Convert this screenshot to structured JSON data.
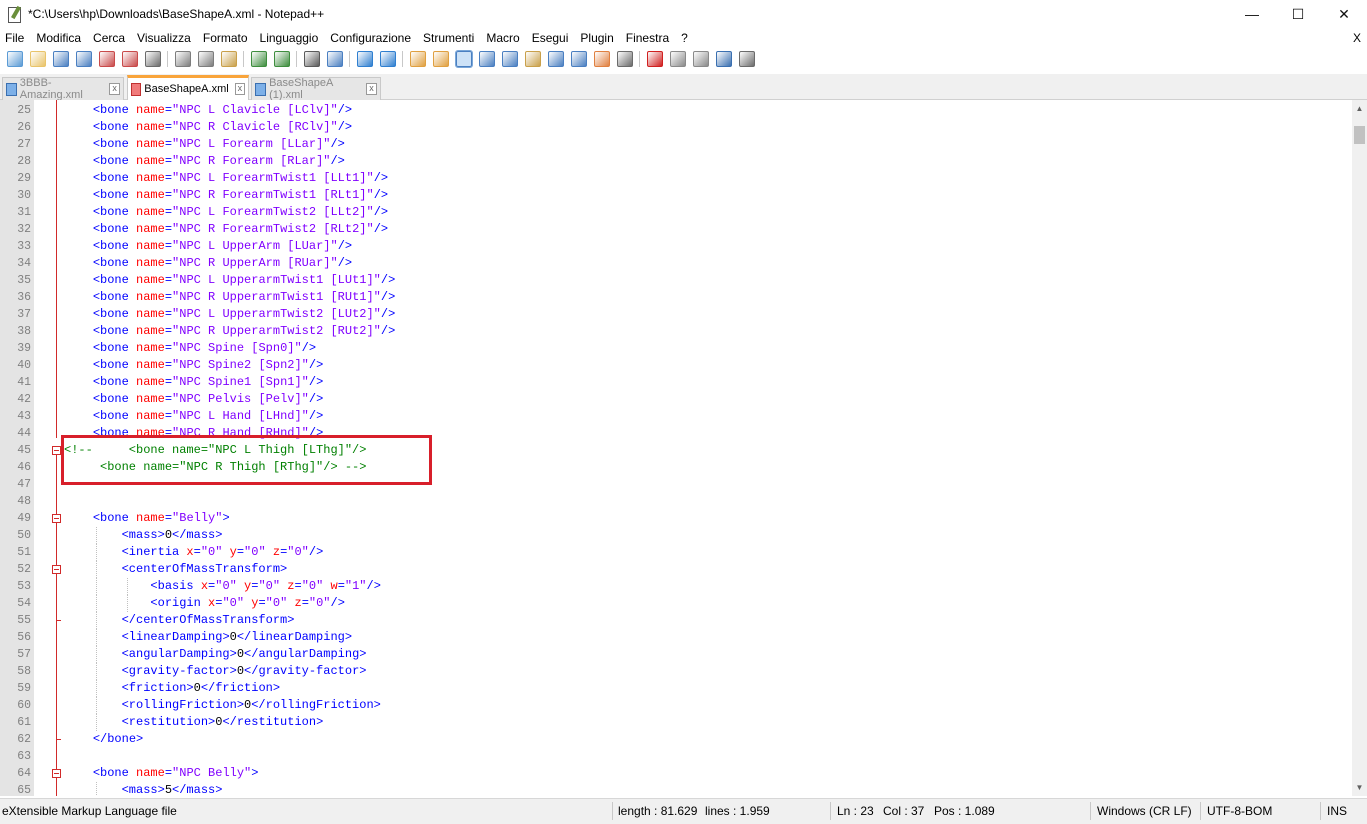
{
  "window": {
    "title": "*C:\\Users\\hp\\Downloads\\BaseShapeA.xml - Notepad++",
    "minimize_glyph": "—",
    "maximize_glyph": "☐",
    "close_glyph": "✕"
  },
  "menu": {
    "items": [
      "File",
      "Modifica",
      "Cerca",
      "Visualizza",
      "Formato",
      "Linguaggio",
      "Configurazione",
      "Strumenti",
      "Macro",
      "Esegui",
      "Plugin",
      "Finestra",
      "?"
    ],
    "close_glyph": "X"
  },
  "toolbar": {
    "buttons": [
      "new-file",
      "open-file",
      "save",
      "save-all",
      "close",
      "close-all",
      "print",
      "cut",
      "copy",
      "paste",
      "undo",
      "redo",
      "find",
      "replace",
      "zoom-in",
      "zoom-out",
      "sync-vertical",
      "sync-horizontal",
      "word-wrap",
      "show-all-characters",
      "indent-guide",
      "define-language",
      "document-map",
      "function-list",
      "folder-as-workspace",
      "monitoring",
      "record-macro",
      "stop-recording",
      "playback-macro",
      "run-macro-multiple",
      "save-macro"
    ]
  },
  "tabs": [
    {
      "label": "3BBB-Amazing.xml",
      "active": false,
      "close": "x"
    },
    {
      "label": "BaseShapeA.xml",
      "active": true,
      "close": "x"
    },
    {
      "label": "BaseShapeA (1).xml",
      "active": false,
      "close": "x"
    }
  ],
  "editor": {
    "lines": [
      {
        "n": "25",
        "text": "    <bone name=\"NPC L Clavicle [LClv]\"/>"
      },
      {
        "n": "26",
        "text": "    <bone name=\"NPC R Clavicle [RClv]\"/>"
      },
      {
        "n": "27",
        "text": "    <bone name=\"NPC L Forearm [LLar]\"/>"
      },
      {
        "n": "28",
        "text": "    <bone name=\"NPC R Forearm [RLar]\"/>"
      },
      {
        "n": "29",
        "text": "    <bone name=\"NPC L ForearmTwist1 [LLt1]\"/>"
      },
      {
        "n": "30",
        "text": "    <bone name=\"NPC R ForearmTwist1 [RLt1]\"/>"
      },
      {
        "n": "31",
        "text": "    <bone name=\"NPC L ForearmTwist2 [LLt2]\"/>"
      },
      {
        "n": "32",
        "text": "    <bone name=\"NPC R ForearmTwist2 [RLt2]\"/>"
      },
      {
        "n": "33",
        "text": "    <bone name=\"NPC L UpperArm [LUar]\"/>"
      },
      {
        "n": "34",
        "text": "    <bone name=\"NPC R UpperArm [RUar]\"/>"
      },
      {
        "n": "35",
        "text": "    <bone name=\"NPC L UpperarmTwist1 [LUt1]\"/>"
      },
      {
        "n": "36",
        "text": "    <bone name=\"NPC R UpperarmTwist1 [RUt1]\"/>"
      },
      {
        "n": "37",
        "text": "    <bone name=\"NPC L UpperarmTwist2 [LUt2]\"/>"
      },
      {
        "n": "38",
        "text": "    <bone name=\"NPC R UpperarmTwist2 [RUt2]\"/>"
      },
      {
        "n": "39",
        "text": "    <bone name=\"NPC Spine [Spn0]\"/>"
      },
      {
        "n": "40",
        "text": "    <bone name=\"NPC Spine2 [Spn2]\"/>"
      },
      {
        "n": "41",
        "text": "    <bone name=\"NPC Spine1 [Spn1]\"/>"
      },
      {
        "n": "42",
        "text": "    <bone name=\"NPC Pelvis [Pelv]\"/>"
      },
      {
        "n": "43",
        "text": "    <bone name=\"NPC L Hand [LHnd]\"/>"
      },
      {
        "n": "44",
        "text": "    <bone name=\"NPC R Hand [RHnd]\"/>"
      },
      {
        "n": "45",
        "text": "<!--     <bone name=\"NPC L Thigh [LThg]\"/>",
        "comment": true,
        "fold": "start"
      },
      {
        "n": "46",
        "text": "     <bone name=\"NPC R Thigh [RThg]\"/> -->",
        "comment": true
      },
      {
        "n": "47",
        "text": ""
      },
      {
        "n": "48",
        "text": ""
      },
      {
        "n": "49",
        "text": "    <bone name=\"Belly\">",
        "fold": "start"
      },
      {
        "n": "50",
        "text": "        <mass>0</mass>"
      },
      {
        "n": "51",
        "text": "        <inertia x=\"0\" y=\"0\" z=\"0\"/>"
      },
      {
        "n": "52",
        "text": "        <centerOfMassTransform>",
        "fold": "start"
      },
      {
        "n": "53",
        "text": "            <basis x=\"0\" y=\"0\" z=\"0\" w=\"1\"/>"
      },
      {
        "n": "54",
        "text": "            <origin x=\"0\" y=\"0\" z=\"0\"/>"
      },
      {
        "n": "55",
        "text": "        </centerOfMassTransform>",
        "fold": "end"
      },
      {
        "n": "56",
        "text": "        <linearDamping>0</linearDamping>"
      },
      {
        "n": "57",
        "text": "        <angularDamping>0</angularDamping>"
      },
      {
        "n": "58",
        "text": "        <gravity-factor>0</gravity-factor>"
      },
      {
        "n": "59",
        "text": "        <friction>0</friction>"
      },
      {
        "n": "60",
        "text": "        <rollingFriction>0</rollingFriction>"
      },
      {
        "n": "61",
        "text": "        <restitution>0</restitution>"
      },
      {
        "n": "62",
        "text": "    </bone>",
        "fold": "end"
      },
      {
        "n": "63",
        "text": ""
      },
      {
        "n": "64",
        "text": "    <bone name=\"NPC Belly\">",
        "fold": "start"
      },
      {
        "n": "65",
        "text": "        <mass>5</mass>"
      }
    ]
  },
  "status": {
    "file_type": "eXtensible Markup Language file",
    "length": "length : 81.629",
    "lines": "lines : 1.959",
    "ln": "Ln : 23",
    "col": "Col : 37",
    "pos": "Pos : 1.089",
    "eol": "Windows (CR LF)",
    "encoding": "UTF-8-BOM",
    "mode": "INS"
  },
  "colors": {
    "tag": "#0000ff",
    "attribute": "#ff0000",
    "value": "#8000ff",
    "comment": "#008000",
    "highlight_box": "#d81f2a",
    "active_tab_accent": "#f9a43a"
  }
}
